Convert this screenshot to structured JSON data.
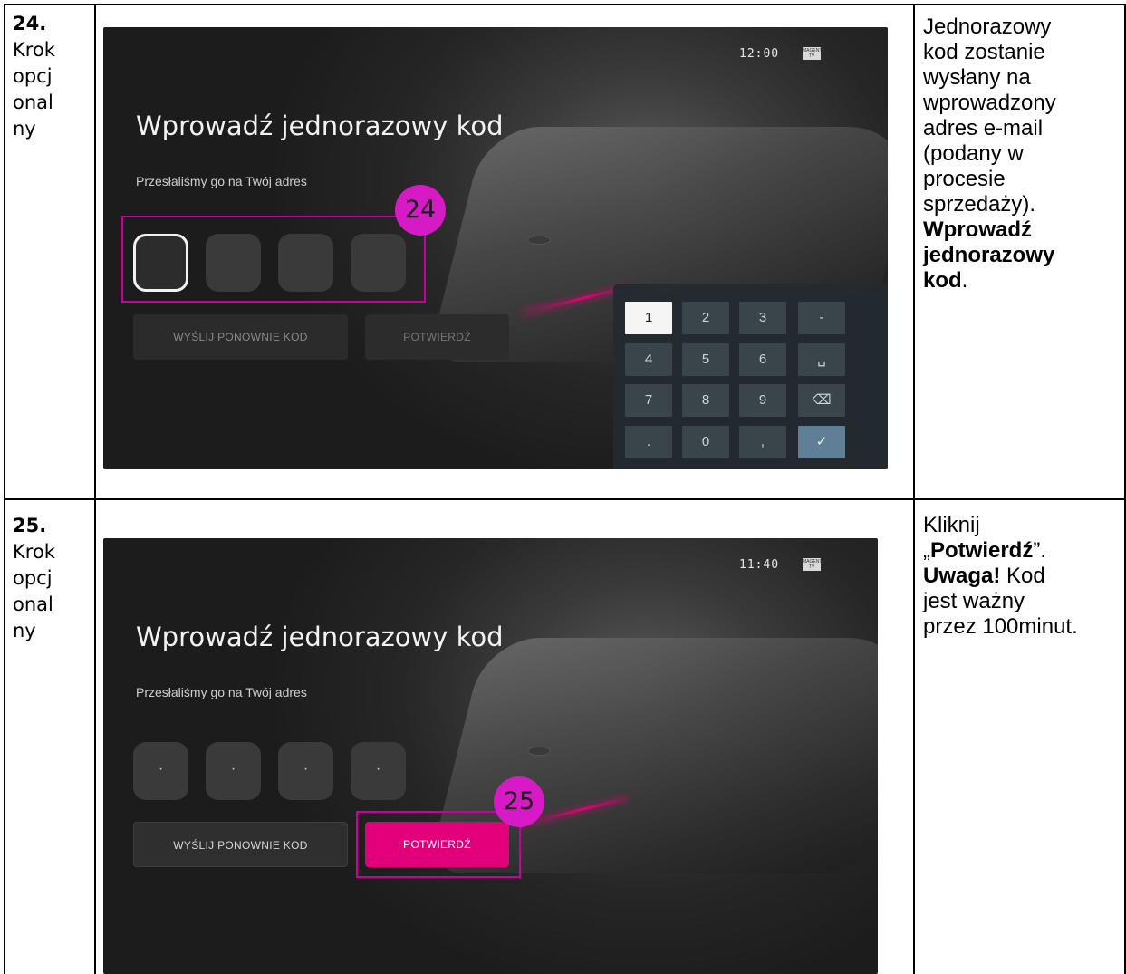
{
  "rows": [
    {
      "step_number": "24.",
      "step_lines": [
        "Krok",
        "opcj",
        "onal",
        "ny"
      ],
      "screen": {
        "clock": "12:00",
        "brand_logo": "MAGENTA TV",
        "title": "Wprowadź jednorazowy kod",
        "subtitle": "Przesłaliśmy go na Twój adres",
        "code_boxes": [
          "",
          "",
          "",
          ""
        ],
        "resend_button": "WYŚLIJ PONOWNIE KOD",
        "confirm_button": "POTWIERDŹ",
        "keypad": [
          "1",
          "2",
          "3",
          "-",
          "4",
          "5",
          "6",
          "␣",
          "7",
          "8",
          "9",
          "⌫",
          ".",
          "0",
          ",",
          "✓"
        ]
      },
      "annotation": "24",
      "description_lines": [
        "Jednorazowy",
        "kod zostanie",
        "wysłany na",
        "wprowadzony",
        "adres e-mail",
        "(podany w",
        "procesie",
        "sprzedaży)."
      ],
      "description_bold": [
        "Wprowadź",
        "jednorazowy",
        "kod"
      ],
      "description_tail": "."
    },
    {
      "step_number": "25.",
      "step_lines": [
        "Krok",
        "opcj",
        "onal",
        "ny"
      ],
      "screen": {
        "clock": "11:40",
        "brand_logo": "MAGENTA TV",
        "title": "Wprowadź jednorazowy kod",
        "subtitle": "Przesłaliśmy go na Twój adres",
        "code_boxes": [
          "·",
          "·",
          "·",
          "·"
        ],
        "resend_button": "WYŚLIJ PONOWNIE KOD",
        "confirm_button": "POTWIERDŹ"
      },
      "annotation": "25",
      "description_l1": "Kliknij",
      "description_l2_open": "„",
      "description_l2_bold": "Potwierdź",
      "description_l2_close": "”.",
      "description_l3_bold": "Uwaga!",
      "description_l3": " Kod",
      "description_l4": "jest ważny",
      "description_l5": "przez 100minut."
    }
  ],
  "colors": {
    "accent": "#e2007a",
    "annotation": "#d51ac6"
  }
}
